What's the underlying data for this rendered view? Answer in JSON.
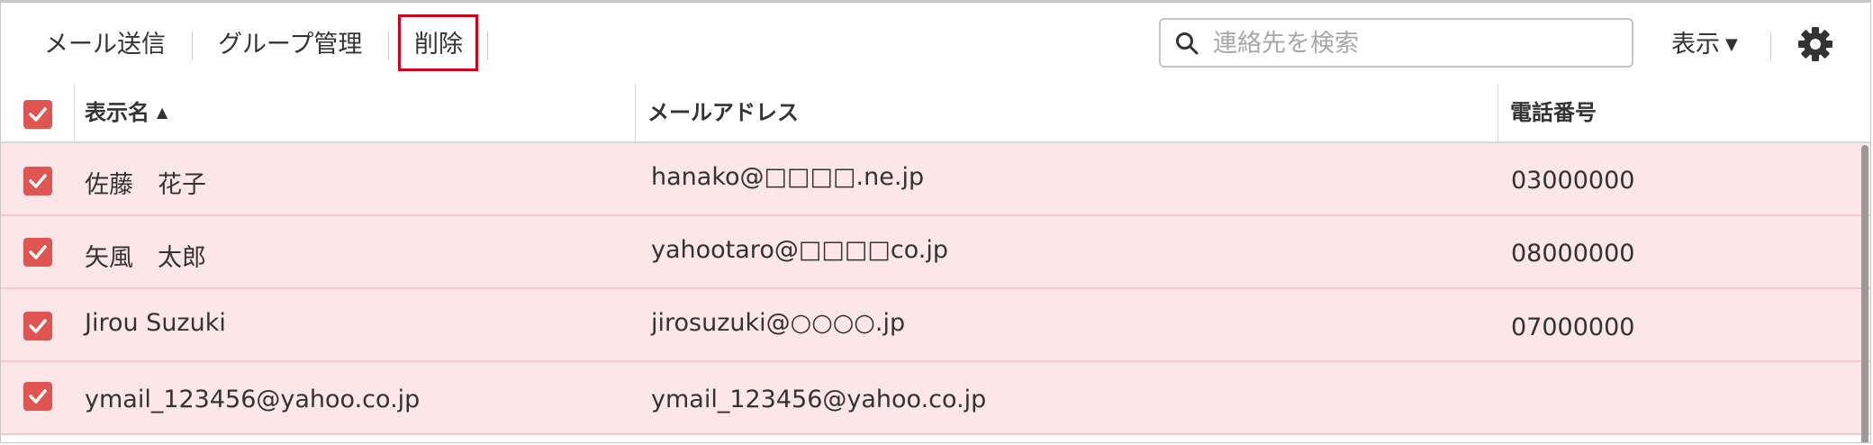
{
  "toolbar": {
    "send_mail": "メール送信",
    "group_manage": "グループ管理",
    "delete": "削除",
    "search_placeholder": "連絡先を検索",
    "view": "表示",
    "view_caret": "▼"
  },
  "table": {
    "headers": {
      "display_name": "表示名",
      "sort_indicator": "▲",
      "email": "メールアドレス",
      "phone": "電話番号"
    },
    "rows": [
      {
        "name": "佐藤　花子",
        "email": "hanako@□□□□.ne.jp",
        "phone": "03000000"
      },
      {
        "name": "矢風　太郎",
        "email": "yahootaro@□□□□co.jp",
        "phone": "08000000"
      },
      {
        "name": "Jirou Suzuki",
        "email": "jirosuzuki@○○○○.jp",
        "phone": "07000000"
      },
      {
        "name": "ymail_123456@yahoo.co.jp",
        "email": "ymail_123456@yahoo.co.jp",
        "phone": ""
      }
    ]
  },
  "colors": {
    "accent": "#e05552",
    "row_selected_bg": "#fde6e7",
    "highlight_border": "#d0021b"
  },
  "icons": {
    "search": "search-icon",
    "gear": "gear-icon",
    "check": "check-icon"
  }
}
